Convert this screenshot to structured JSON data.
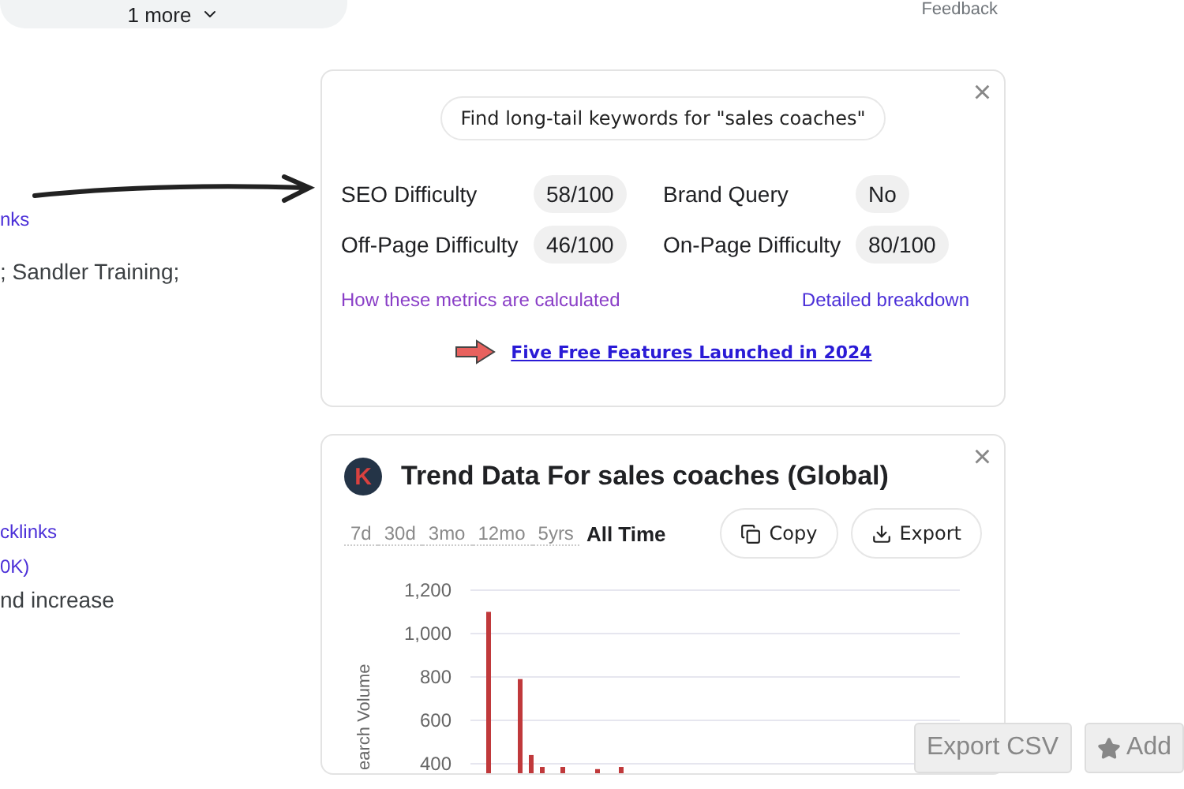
{
  "top_bar": {
    "more_chip": "1 more",
    "feedback": "Feedback"
  },
  "left_fragments": [
    {
      "text": "nks",
      "kind": "link"
    },
    {
      "text": "; Sandler Training;",
      "kind": "plain"
    },
    {
      "text": "cklinks",
      "kind": "link"
    },
    {
      "text": "0K)",
      "kind": "link"
    },
    {
      "text": "nd increase",
      "kind": "plain"
    }
  ],
  "metrics_card": {
    "suggestion": "Find long-tail keywords for \"sales coaches\"",
    "close": "×",
    "metrics": [
      {
        "label": "SEO Difficulty",
        "value": "58/100"
      },
      {
        "label": "Brand Query",
        "value": "No"
      },
      {
        "label": "Off-Page Difficulty",
        "value": "46/100"
      },
      {
        "label": "On-Page Difficulty",
        "value": "80/100"
      }
    ],
    "links": [
      "How these metrics are calculated",
      "Detailed breakdown"
    ],
    "promo": "Five Free Features Launched in 2024"
  },
  "trend_card": {
    "logo": "K",
    "title": "Trend Data For sales coaches (Global)",
    "close": "×",
    "ranges": [
      {
        "label": "7d",
        "selected": false
      },
      {
        "label": "30d",
        "selected": false
      },
      {
        "label": "3mo",
        "selected": false
      },
      {
        "label": "12mo",
        "selected": false
      },
      {
        "label": "5yrs",
        "selected": false
      },
      {
        "label": "All Time",
        "selected": true
      }
    ],
    "actions": [
      {
        "label": "Copy",
        "kind": "copy"
      },
      {
        "label": "Export",
        "kind": "export"
      }
    ],
    "chart_data": {
      "type": "bar",
      "ylabel": "earch Volume",
      "grid": true,
      "ylim": [
        356,
        1200
      ],
      "yticks": [
        {
          "value": 400,
          "label": "400"
        },
        {
          "value": 600,
          "label": "600"
        },
        {
          "value": 800,
          "label": "800"
        },
        {
          "value": 1000,
          "label": "1,000"
        },
        {
          "value": 1200,
          "label": "1,200"
        }
      ],
      "series": [
        {
          "color": "#c0393b",
          "values": [
            1100,
            790,
            440,
            385,
            385,
            375,
            385
          ]
        }
      ]
    }
  },
  "floating_buttons": [
    {
      "label": "Export CSV",
      "kind": "plain"
    },
    {
      "label": "Add",
      "kind": "star"
    }
  ]
}
